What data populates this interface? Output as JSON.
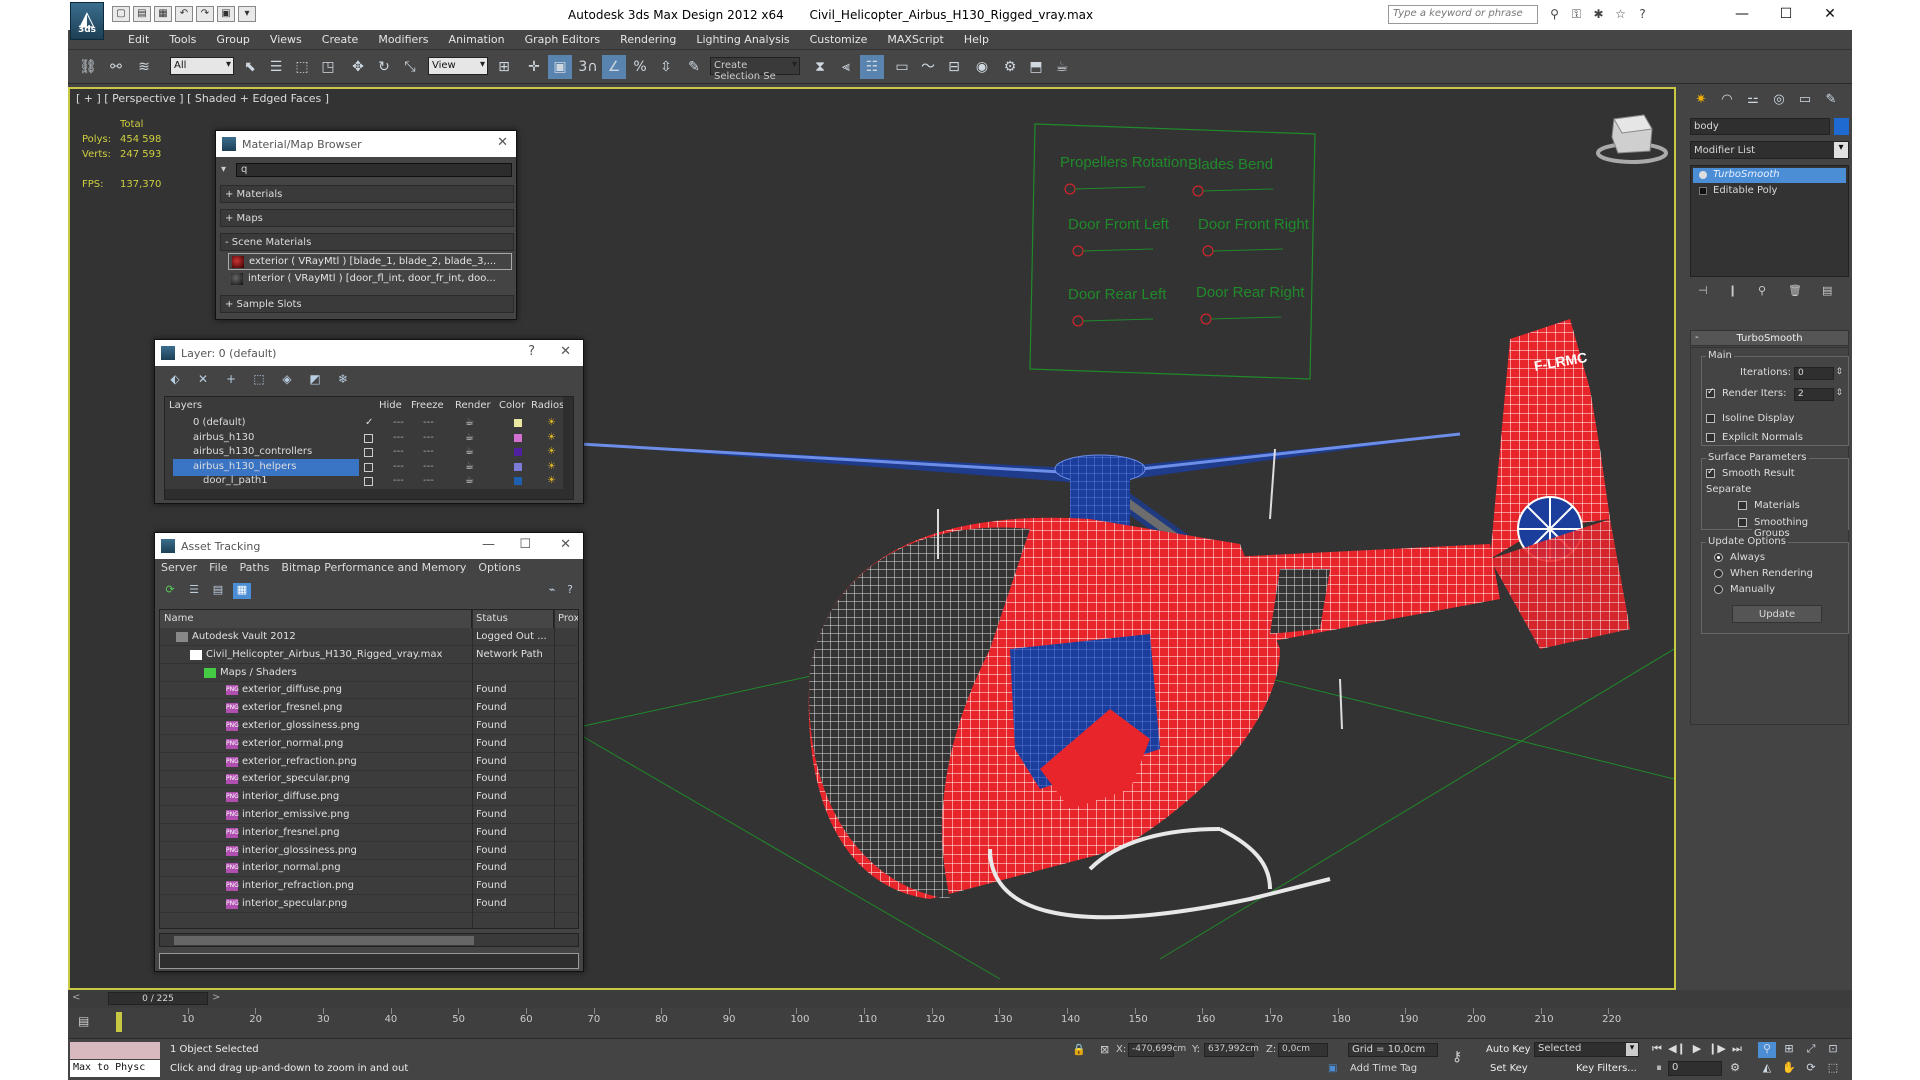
{
  "app": {
    "title": "Autodesk 3ds Max Design 2012 x64",
    "file": "Civil_Helicopter_Airbus_H130_Rigged_vray.max",
    "logo_text": "3ds",
    "search_placeholder": "Type a keyword or phrase"
  },
  "menu": [
    "Edit",
    "Tools",
    "Group",
    "Views",
    "Create",
    "Modifiers",
    "Animation",
    "Graph Editors",
    "Rendering",
    "Lighting Analysis",
    "Customize",
    "MAXScript",
    "Help"
  ],
  "toolbar": {
    "selection_filter": "All",
    "ref_coord": "View",
    "named_selection": "Create Selection Se",
    "snap_label": "3"
  },
  "viewport": {
    "label": "[ + ] [ Perspective ] [ Shaded + Edged Faces ]",
    "stats": {
      "total_label": "Total",
      "polys_label": "Polys:",
      "polys": "454 598",
      "verts_label": "Verts:",
      "verts": "247 593",
      "fps_label": "FPS:",
      "fps": "137,370"
    },
    "controls_board": {
      "labels": [
        "Propellers Rotation",
        "Blades Bend",
        "Door Front Left",
        "Door Front Right",
        "Door Rear Left",
        "Door Rear Right"
      ]
    },
    "tail_reg": "F-LRMC"
  },
  "material_browser": {
    "title": "Material/Map Browser",
    "filter_value": "q",
    "groups": [
      "+ Materials",
      "+ Maps",
      "- Scene Materials",
      "+ Sample Slots"
    ],
    "items": [
      "exterior  ( VRayMtl ) [blade_1, blade_2, blade_3,...",
      "interior  ( VRayMtl ) [door_fl_int, door_fr_int, doo..."
    ]
  },
  "layer_panel": {
    "title": "Layer: 0 (default)",
    "columns": [
      "Layers",
      "Hide",
      "Freeze",
      "Render",
      "Color",
      "Radiosi"
    ],
    "rows": [
      {
        "name": "0 (default)",
        "color": "#e8e8a0"
      },
      {
        "name": "airbus_h130",
        "color": "#d070d0"
      },
      {
        "name": "airbus_h130_controllers",
        "color": "#5020a0"
      },
      {
        "name": "airbus_h130_helpers",
        "color": "#7c7cd8"
      },
      {
        "name": "door_l_path1",
        "color": "#1f5fb0"
      }
    ]
  },
  "asset_tracking": {
    "title": "Asset Tracking",
    "menu": [
      "Server",
      "File",
      "Paths",
      "Bitmap Performance and Memory",
      "Options"
    ],
    "columns": [
      "Name",
      "Status",
      "Proxy"
    ],
    "rows": [
      {
        "name": "Autodesk Vault 2012",
        "status": "Logged Out ...",
        "indent": 0,
        "icon": "vault"
      },
      {
        "name": "Civil_Helicopter_Airbus_H130_Rigged_vray.max",
        "status": "Network Path",
        "indent": 1,
        "icon": "file"
      },
      {
        "name": "Maps / Shaders",
        "status": "",
        "indent": 2,
        "icon": "folder"
      },
      {
        "name": "exterior_diffuse.png",
        "status": "Found",
        "indent": 3,
        "icon": "png"
      },
      {
        "name": "exterior_fresnel.png",
        "status": "Found",
        "indent": 3,
        "icon": "png"
      },
      {
        "name": "exterior_glossiness.png",
        "status": "Found",
        "indent": 3,
        "icon": "png"
      },
      {
        "name": "exterior_normal.png",
        "status": "Found",
        "indent": 3,
        "icon": "png"
      },
      {
        "name": "exterior_refraction.png",
        "status": "Found",
        "indent": 3,
        "icon": "png"
      },
      {
        "name": "exterior_specular.png",
        "status": "Found",
        "indent": 3,
        "icon": "png"
      },
      {
        "name": "interior_diffuse.png",
        "status": "Found",
        "indent": 3,
        "icon": "png"
      },
      {
        "name": "interior_emissive.png",
        "status": "Found",
        "indent": 3,
        "icon": "png"
      },
      {
        "name": "interior_fresnel.png",
        "status": "Found",
        "indent": 3,
        "icon": "png"
      },
      {
        "name": "interior_glossiness.png",
        "status": "Found",
        "indent": 3,
        "icon": "png"
      },
      {
        "name": "interior_normal.png",
        "status": "Found",
        "indent": 3,
        "icon": "png"
      },
      {
        "name": "interior_refraction.png",
        "status": "Found",
        "indent": 3,
        "icon": "png"
      },
      {
        "name": "interior_specular.png",
        "status": "Found",
        "indent": 3,
        "icon": "png"
      }
    ]
  },
  "command_panel": {
    "object_name": "body",
    "object_color": "#1e6ad0",
    "modifier_list": "Modifier List",
    "stack": [
      "TurboSmooth",
      "Editable Poly"
    ],
    "rollout_title": "TurboSmooth",
    "main": {
      "label": "Main",
      "iterations_label": "Iterations:",
      "iterations": "0",
      "render_iters_label": "Render Iters:",
      "render_iters": "2",
      "isoline": "Isoline Display",
      "explicit": "Explicit Normals"
    },
    "surface": {
      "label": "Surface Parameters",
      "smooth": "Smooth Result",
      "separate": "Separate",
      "materials": "Materials",
      "smoothing_groups": "Smoothing Groups"
    },
    "update": {
      "label": "Update Options",
      "always": "Always",
      "when_rendering": "When Rendering",
      "manually": "Manually",
      "button": "Update"
    }
  },
  "timeline": {
    "slider": "0 / 225",
    "ticks": [
      10,
      20,
      30,
      40,
      50,
      60,
      70,
      80,
      90,
      100,
      110,
      120,
      130,
      140,
      150,
      160,
      170,
      180,
      190,
      200,
      210,
      220
    ]
  },
  "status": {
    "maxscript": "Max to Physc",
    "selected": "1 Object Selected",
    "hint": "Click and drag up-and-down to zoom in and out",
    "x_label": "X:",
    "x": "-470,699cm",
    "y_label": "Y:",
    "y": "637,992cm",
    "z_label": "Z:",
    "z": "0,0cm",
    "grid": "Grid = 10,0cm",
    "add_time_tag": "Add Time Tag",
    "auto_key": "Auto Key",
    "set_key": "Set Key",
    "selected_set": "Selected",
    "key_filters": "Key Filters...",
    "frame": "0"
  },
  "colors": {
    "accent": "#4c8ed6",
    "viewport_border": "#c8c843",
    "stats": "#cfcf40",
    "wire_red": "#e8252a",
    "wire_blue": "#1b3d9c",
    "control_green": "#1f8a2a"
  }
}
